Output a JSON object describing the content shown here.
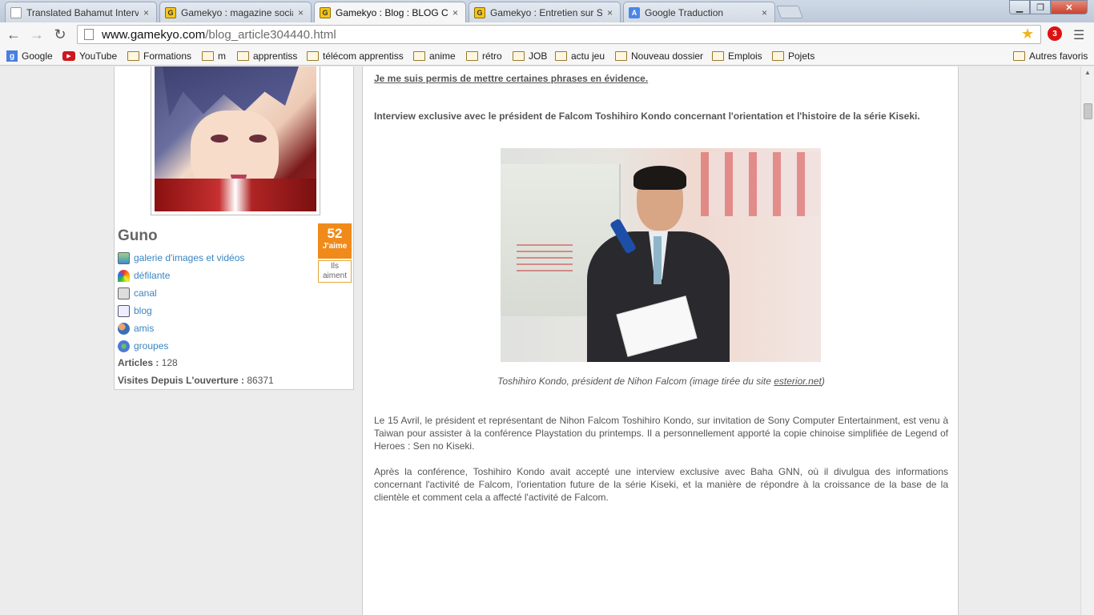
{
  "browser": {
    "tabs": [
      {
        "label": "Translated Bahamut Interv",
        "icon": "document-icon"
      },
      {
        "label": "Gamekyo : magazine socia",
        "icon": "gamekyo-icon"
      },
      {
        "label": "Gamekyo : Blog : BLOG Ch",
        "icon": "gamekyo-icon",
        "active": true
      },
      {
        "label": "Gamekyo : Entretien sur Se",
        "icon": "gamekyo-icon"
      },
      {
        "label": "Google Traduction",
        "icon": "google-translate-icon"
      }
    ],
    "tab_close": "×",
    "url_host": "www.gamekyo.com",
    "url_path": "/blog_article304440.html",
    "extension_badge": "3",
    "bookmarks": [
      {
        "label": "Google",
        "icon": "google-icon"
      },
      {
        "label": "YouTube",
        "icon": "youtube-icon"
      },
      {
        "label": "Formations",
        "icon": "folder-icon"
      },
      {
        "label": "m",
        "icon": "folder-icon"
      },
      {
        "label": "apprentiss",
        "icon": "folder-icon"
      },
      {
        "label": "télécom apprentiss",
        "icon": "folder-icon"
      },
      {
        "label": "anime",
        "icon": "folder-icon"
      },
      {
        "label": "rétro",
        "icon": "folder-icon"
      },
      {
        "label": "JOB",
        "icon": "folder-icon"
      },
      {
        "label": "actu jeu",
        "icon": "folder-icon"
      },
      {
        "label": "Nouveau dossier",
        "icon": "folder-icon"
      },
      {
        "label": "Emplois",
        "icon": "folder-icon"
      },
      {
        "label": "Pojets",
        "icon": "folder-icon"
      }
    ],
    "other_bookmarks": "Autres favoris"
  },
  "profile": {
    "username": "Guno",
    "likes_count": "52",
    "likes_label": "J'aime",
    "likers_label": "Ils aiment",
    "links": [
      {
        "label": "galerie d'images et vidéos",
        "icon": "gallery-icon"
      },
      {
        "label": "défilante",
        "icon": "rainbow-icon"
      },
      {
        "label": "canal",
        "icon": "channel-icon"
      },
      {
        "label": "blog",
        "icon": "blog-icon"
      },
      {
        "label": "amis",
        "icon": "friends-icon"
      },
      {
        "label": "groupes",
        "icon": "groups-icon"
      }
    ],
    "articles_label": "Articles :",
    "articles_value": "128",
    "visits_label": "Visites Depuis L'ouverture :",
    "visits_value": "86371"
  },
  "article": {
    "note": "Je me suis permis de mettre certaines phrases en évidence.",
    "headline": "Interview exclusive avec le président de Falcom Toshihiro Kondo concernant l'orientation et l'histoire de la série Kiseki.",
    "caption_prefix": "Toshihiro Kondo, président de Nihon Falcom (image tirée du site ",
    "caption_link": "esterior.net",
    "caption_suffix": ")",
    "paragraph1": "Le 15 Avril, le président et représentant de Nihon Falcom Toshihiro Kondo, sur invitation de Sony Computer Entertainment, est venu à Taiwan pour assister à la conférence Playstation du printemps. Il a personnellement apporté la copie chinoise simplifiée de Legend of Heroes : Sen no Kiseki.",
    "paragraph2": "Après la conférence, Toshihiro Kondo avait accepté une interview exclusive avec Baha GNN, où il divulgua des informations concernant l'activité de Falcom, l'orientation future de la série Kiseki, et la manière de répondre à la croissance de la base de la clientèle et comment cela a affecté l'activité de Falcom."
  },
  "colors": {
    "link": "#3a85c2",
    "like_badge": "#f08a1a",
    "page_bg": "#ececec"
  }
}
